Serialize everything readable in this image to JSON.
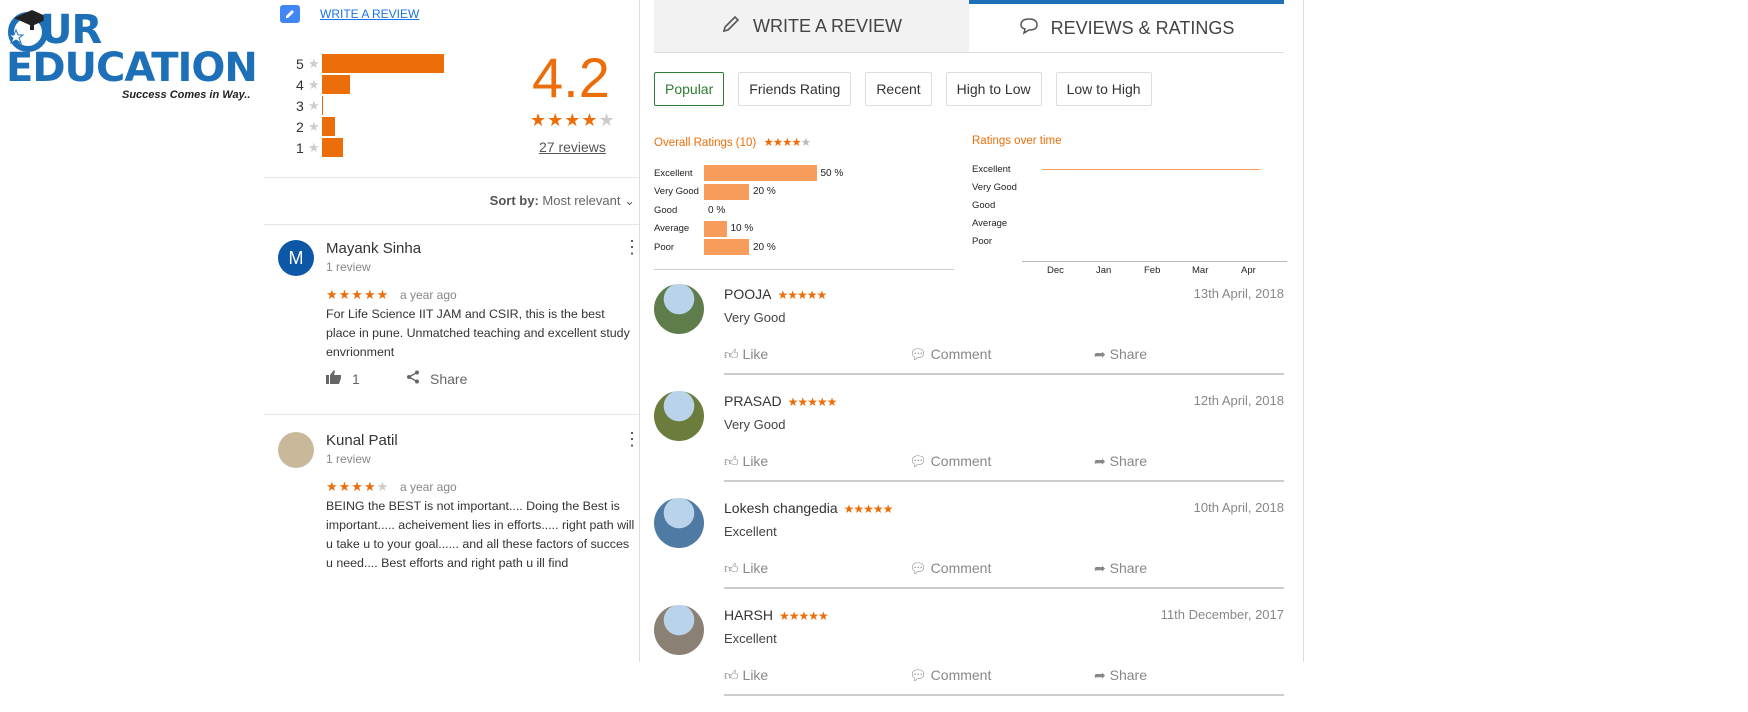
{
  "logo": {
    "line1": "UR",
    "line2": "EDUCATION",
    "tagline": "Success Comes in Way.."
  },
  "left": {
    "write_review_link": "WRITE A REVIEW",
    "histogram": [
      {
        "label": "5",
        "fraction": 1.0
      },
      {
        "label": "4",
        "fraction": 0.23
      },
      {
        "label": "3",
        "fraction": 0.01
      },
      {
        "label": "2",
        "fraction": 0.11
      },
      {
        "label": "1",
        "fraction": 0.17
      }
    ],
    "average": "4.2",
    "average_stars": 4,
    "review_count": "27 reviews",
    "sort_label": "Sort by:",
    "sort_value": "Most relevant",
    "reviews": [
      {
        "avatar_letter": "M",
        "name": "Mayank Sinha",
        "sub": "1 review",
        "stars": 5,
        "ago": "a year ago",
        "text": "For Life Science IIT JAM and CSIR, this is the best place in pune. Unmatched teaching and excellent study envrionment",
        "likes": "1",
        "share": "Share"
      },
      {
        "avatar_letter": "",
        "name": "Kunal Patil",
        "sub": "1 review",
        "stars": 4,
        "ago": "a year ago",
        "text": "BEING the BEST  is not important.... Doing the Best is important..... acheivement lies in efforts..... right path will u take u to your goal...... and all these  factors of succes u need....  Best efforts and right path u ill find"
      }
    ]
  },
  "right": {
    "tabs": [
      {
        "label": "WRITE A REVIEW"
      },
      {
        "label": "REVIEWS & RATINGS"
      }
    ],
    "filters": [
      "Popular",
      "Friends Rating",
      "Recent",
      "High to Low",
      "Low to High"
    ],
    "overall_title": "Overall Ratings (10)",
    "overall_stars": 3.5,
    "time_title": "Ratings over time",
    "overall_bars": [
      {
        "label": "Excellent",
        "value": 50,
        "pct": "50 %"
      },
      {
        "label": "Very Good",
        "value": 20,
        "pct": "20 %"
      },
      {
        "label": "Good",
        "value": 0,
        "pct": "0 %"
      },
      {
        "label": "Average",
        "value": 10,
        "pct": "10 %"
      },
      {
        "label": "Poor",
        "value": 20,
        "pct": "20 %"
      }
    ],
    "time_ylabels": [
      "Excellent",
      "Very Good",
      "Good",
      "Average",
      "Poor"
    ],
    "time_xlabels": [
      "Dec",
      "Jan",
      "Feb",
      "Mar",
      "Apr"
    ],
    "items": [
      {
        "name": "POOJA",
        "stars": "★★★★★",
        "date": "13th April, 2018",
        "rating": "Very Good",
        "color": "#5e7d4a"
      },
      {
        "name": "PRASAD",
        "stars": "★★★★★",
        "date": "12th April, 2018",
        "rating": "Very Good",
        "color": "#6b7c3d"
      },
      {
        "name": "Lokesh changedia",
        "stars": "★★★★★",
        "date": "10th April, 2018",
        "rating": "Excellent",
        "color": "#4f7aa3"
      },
      {
        "name": "HARSH",
        "stars": "★★★★★",
        "date": "11th December, 2017",
        "rating": "Excellent",
        "color": "#8a8074"
      }
    ],
    "actions": {
      "like": "Like",
      "comment": "Comment",
      "share": "Share"
    }
  }
}
